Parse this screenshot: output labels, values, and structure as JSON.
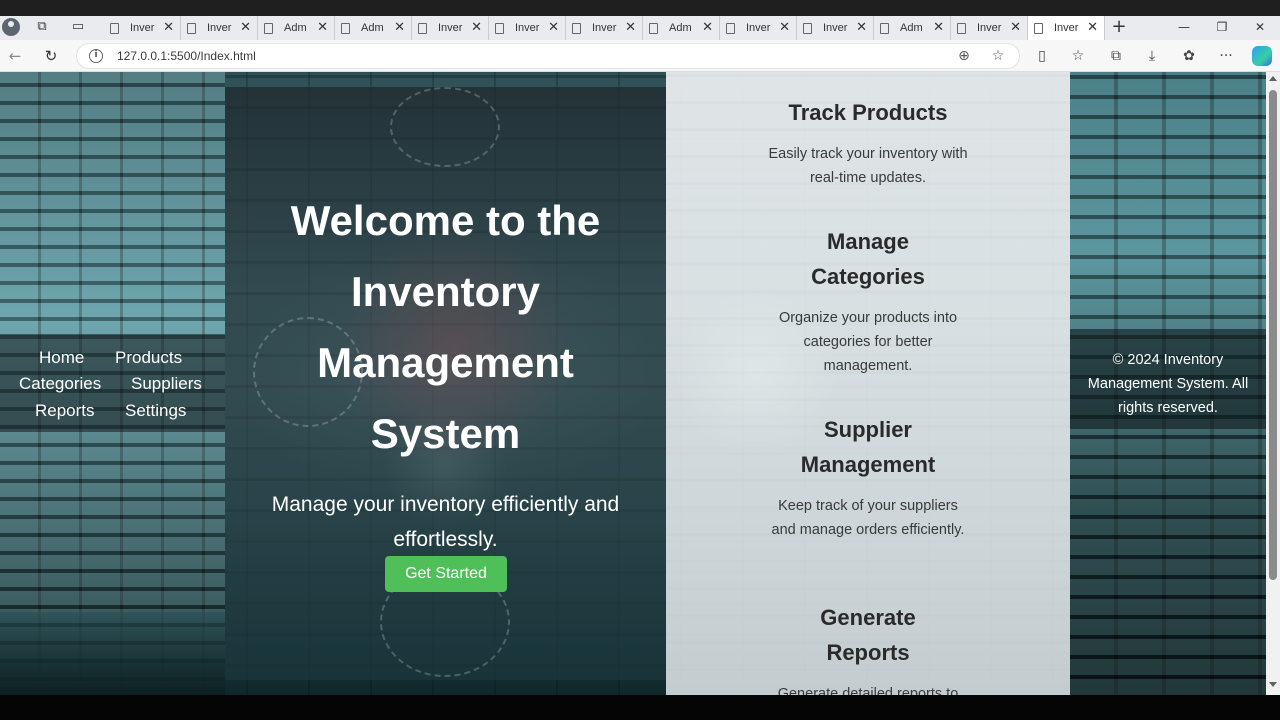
{
  "browser": {
    "tabs": [
      {
        "label": "Inver",
        "active": false
      },
      {
        "label": "Inver",
        "active": false
      },
      {
        "label": "Adm",
        "active": false
      },
      {
        "label": "Adm",
        "active": false
      },
      {
        "label": "Inver",
        "active": false
      },
      {
        "label": "Inver",
        "active": false
      },
      {
        "label": "Inver",
        "active": false
      },
      {
        "label": "Adm",
        "active": false
      },
      {
        "label": "Inver",
        "active": false
      },
      {
        "label": "Inver",
        "active": false
      },
      {
        "label": "Adm",
        "active": false
      },
      {
        "label": "Inver",
        "active": false
      },
      {
        "label": "Inver",
        "active": true
      }
    ],
    "address": "127.0.0.1:5500/Index.html",
    "icons": {
      "back": "←",
      "reload": "↻",
      "info": "i",
      "zoom": "⊕",
      "favorite": "☆",
      "split": "▯",
      "favorites": "☆",
      "collections": "⧉",
      "downloads": "⤓",
      "extensions": "✿",
      "more": "···",
      "new_tab": "+",
      "minimize": "—",
      "restore": "❐",
      "close": "✕"
    }
  },
  "nav": {
    "home": "Home",
    "products": "Products",
    "categories": "Categories",
    "suppliers": "Suppliers",
    "reports": "Reports",
    "settings": "Settings"
  },
  "hero": {
    "title_lines": [
      "Welcome to the",
      "Inventory",
      "Management",
      "System"
    ],
    "subtitle": "Manage your inventory efficiently and effortlessly.",
    "button": "Get Started"
  },
  "features": [
    {
      "title": "Track Products",
      "text": "Easily track your inventory with real-time updates."
    },
    {
      "title": "Manage Categories",
      "text": "Organize your products into categories for better management."
    },
    {
      "title": "Supplier Management",
      "text": "Keep track of your suppliers and manage orders efficiently."
    },
    {
      "title": "Generate Reports",
      "text": "Generate detailed reports to"
    }
  ],
  "footer": {
    "text": "© 2024 Inventory Management System. All rights reserved."
  }
}
